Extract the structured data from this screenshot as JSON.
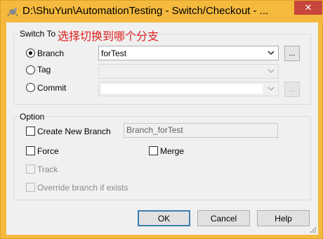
{
  "window": {
    "title": "D:\\ShuYun\\AutomationTesting - Switch/Checkout - ...",
    "close_symbol": "✕",
    "app_icon": "tortoisegit-icon"
  },
  "switch_to": {
    "legend": "Switch To",
    "annotation": "选择切换到哪个分支",
    "branch": {
      "label": "Branch",
      "value": "forTest",
      "selected": true
    },
    "tag": {
      "label": "Tag",
      "value": "",
      "selected": false
    },
    "commit": {
      "label": "Commit",
      "value": "",
      "selected": false
    },
    "browse_label": "..."
  },
  "option": {
    "legend": "Option",
    "create_new_branch": {
      "label": "Create New Branch",
      "checked": false,
      "value": "Branch_forTest"
    },
    "force": {
      "label": "Force",
      "checked": false
    },
    "merge": {
      "label": "Merge",
      "checked": false
    },
    "track": {
      "label": "Track",
      "checked": false,
      "disabled": true
    },
    "override": {
      "label": "Override branch if exists",
      "checked": false,
      "disabled": true
    }
  },
  "buttons": {
    "ok": "OK",
    "cancel": "Cancel",
    "help": "Help"
  }
}
